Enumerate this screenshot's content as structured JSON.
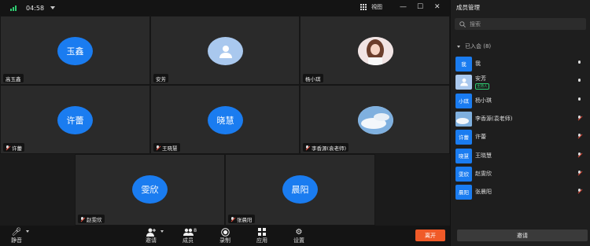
{
  "topbar": {
    "time": "04:58",
    "view_label": "視图",
    "min": "—",
    "max": "☐",
    "close": "✕"
  },
  "tiles": [
    {
      "name": "高玉鑫",
      "avatar_text": "玉鑫",
      "kind": "text",
      "muted": false
    },
    {
      "name": "安芳",
      "avatar_text": "",
      "kind": "person",
      "muted": false
    },
    {
      "name": "杨小琪",
      "avatar_text": "",
      "kind": "photo",
      "muted": false
    },
    {
      "name": "许蕾",
      "avatar_text": "许蕾",
      "kind": "text",
      "muted": true
    },
    {
      "name": "王晓慧",
      "avatar_text": "晓慧",
      "kind": "text",
      "muted": true
    },
    {
      "name": "李香源(袁老师)",
      "avatar_text": "",
      "kind": "sky",
      "muted": true
    },
    {
      "name": "赵雯欣",
      "avatar_text": "雯欣",
      "kind": "text",
      "muted": true
    },
    {
      "name": "张晨阳",
      "avatar_text": "晨阳",
      "kind": "text",
      "muted": true
    }
  ],
  "toolbar": {
    "mute": "静音",
    "invite": "邀请",
    "members": "成员",
    "members_count": "8",
    "record": "录制",
    "apps": "应用",
    "settings": "设置",
    "leave": "离开"
  },
  "panel": {
    "title": "成员管理",
    "search_placeholder": "搜索",
    "section": "已入会 (8)",
    "members": [
      {
        "avatar": "我",
        "name": "我",
        "badge": "",
        "muted": false
      },
      {
        "avatar": "",
        "name": "安芳",
        "badge": "主持人",
        "muted": false
      },
      {
        "avatar": "小琪",
        "name": "杨小琪",
        "badge": "",
        "muted": false
      },
      {
        "avatar": "",
        "name": "李香源(袁老师)",
        "badge": "",
        "muted": true
      },
      {
        "avatar": "许蕾",
        "name": "许蕾",
        "badge": "",
        "muted": true
      },
      {
        "avatar": "晓慧",
        "name": "王晓慧",
        "badge": "",
        "muted": true
      },
      {
        "avatar": "雯欣",
        "name": "赵雯欣",
        "badge": "",
        "muted": true
      },
      {
        "avatar": "晨阳",
        "name": "张晨阳",
        "badge": "",
        "muted": true
      }
    ],
    "invite_label": "邀请"
  },
  "colors": {
    "accent": "#1a7cf0",
    "leave": "#f05a28",
    "host_badge": "#2ecc71"
  }
}
